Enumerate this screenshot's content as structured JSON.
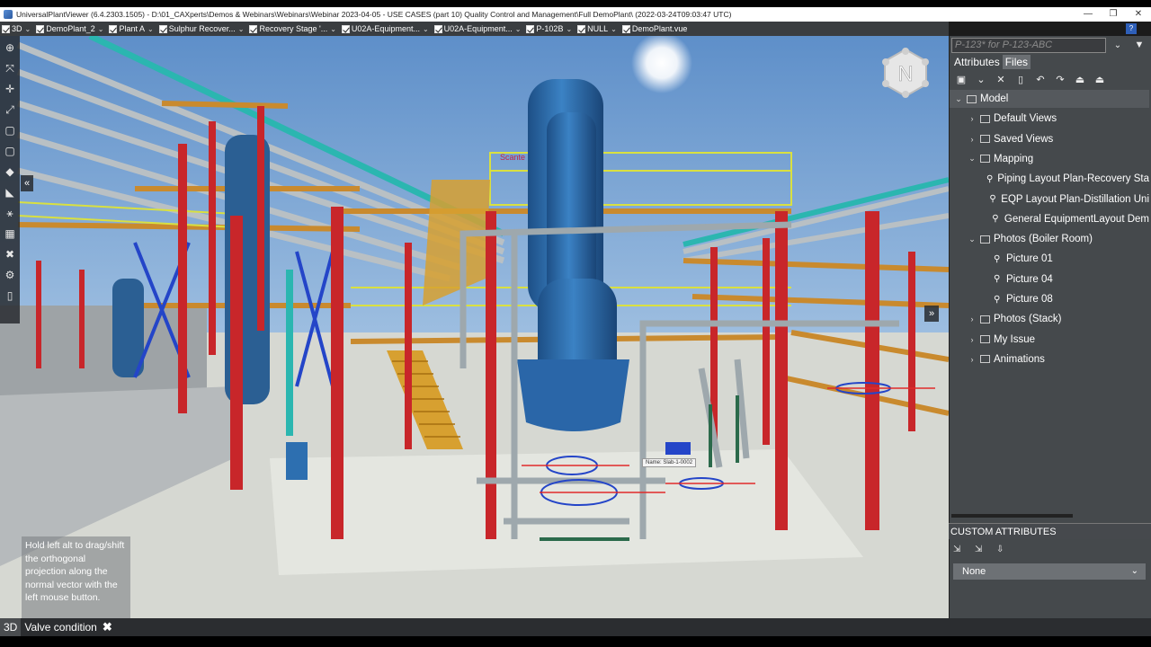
{
  "window": {
    "title": "UniversalPlantViewer (6.4.2303.1505) - D:\\01_CAXperts\\Demos & Webinars\\Webinars\\Webinar 2023-04-05 - USE CASES (part 10) Quality Control and Management\\Full DemoPlant\\ (2022-03-24T09:03:47 UTC)",
    "minimize": "—",
    "restore": "❐",
    "close": "✕",
    "help": "?"
  },
  "tags": [
    {
      "label": "3D"
    },
    {
      "label": "DemoPlant_2"
    },
    {
      "label": "Plant A"
    },
    {
      "label": "Sulphur Recover..."
    },
    {
      "label": "Recovery Stage '..."
    },
    {
      "label": "U02A-Equipment..."
    },
    {
      "label": "U02A-Equipment..."
    },
    {
      "label": "P-102B"
    },
    {
      "label": "NULL"
    },
    {
      "label": "DemoPlant.vue"
    }
  ],
  "viewport": {
    "compass_letter": "N",
    "hint_text": "Hold left alt to drag/shift the orthogonal projection along the normal vector with the left mouse button.",
    "tooltip_text": "Name: Slab-1-0002",
    "label_scanner": "Scante",
    "collapse_left": "«",
    "collapse_right": "»"
  },
  "left_tools": [
    "⊕",
    "⤧",
    "✛",
    "⤢",
    "▢",
    "▢",
    "◆",
    "◣",
    "⚹",
    "▦",
    "✖",
    "⚙",
    "▯"
  ],
  "status": {
    "mode": "3D",
    "text": "Valve condition",
    "close": "✖"
  },
  "right_panel": {
    "search_placeholder": "P-123* for P-123-ABC",
    "tabs": [
      {
        "label": "Attributes",
        "active": false
      },
      {
        "label": "Files",
        "active": true
      }
    ],
    "tree": [
      {
        "label": "Model",
        "level": 0,
        "expanded": true,
        "icon": "folder"
      },
      {
        "label": "Default Views",
        "level": 1,
        "expanded": false,
        "icon": "folder"
      },
      {
        "label": "Saved Views",
        "level": 1,
        "expanded": false,
        "icon": "folder"
      },
      {
        "label": "Mapping",
        "level": 1,
        "expanded": true,
        "icon": "folder"
      },
      {
        "label": "Piping Layout Plan-Recovery Sta",
        "level": 2,
        "icon": "pin"
      },
      {
        "label": "EQP Layout Plan-Distillation Uni",
        "level": 2,
        "icon": "pin"
      },
      {
        "label": "General EquipmentLayout Dem",
        "level": 2,
        "icon": "pin"
      },
      {
        "label": "Photos (Boiler Room)",
        "level": 1,
        "expanded": true,
        "icon": "folder"
      },
      {
        "label": "Picture 01",
        "level": 2,
        "icon": "pin"
      },
      {
        "label": "Picture 04",
        "level": 2,
        "icon": "pin"
      },
      {
        "label": "Picture 08",
        "level": 2,
        "icon": "pin"
      },
      {
        "label": "Photos (Stack)",
        "level": 1,
        "expanded": false,
        "icon": "folder"
      },
      {
        "label": "My Issue",
        "level": 1,
        "expanded": false,
        "icon": "folder"
      },
      {
        "label": "Animations",
        "level": 1,
        "expanded": false,
        "icon": "folder"
      }
    ],
    "custom_attributes": {
      "header": "CUSTOM ATTRIBUTES",
      "selected": "None"
    }
  },
  "colors": {
    "steel_red": "#c8262a",
    "beam_orange": "#c98a2e",
    "vessel_blue": "#2d6fb0",
    "rail_yellow": "#d9e040",
    "pipe_grey": "#a9b2b6",
    "sky": "#8fb6dd"
  }
}
